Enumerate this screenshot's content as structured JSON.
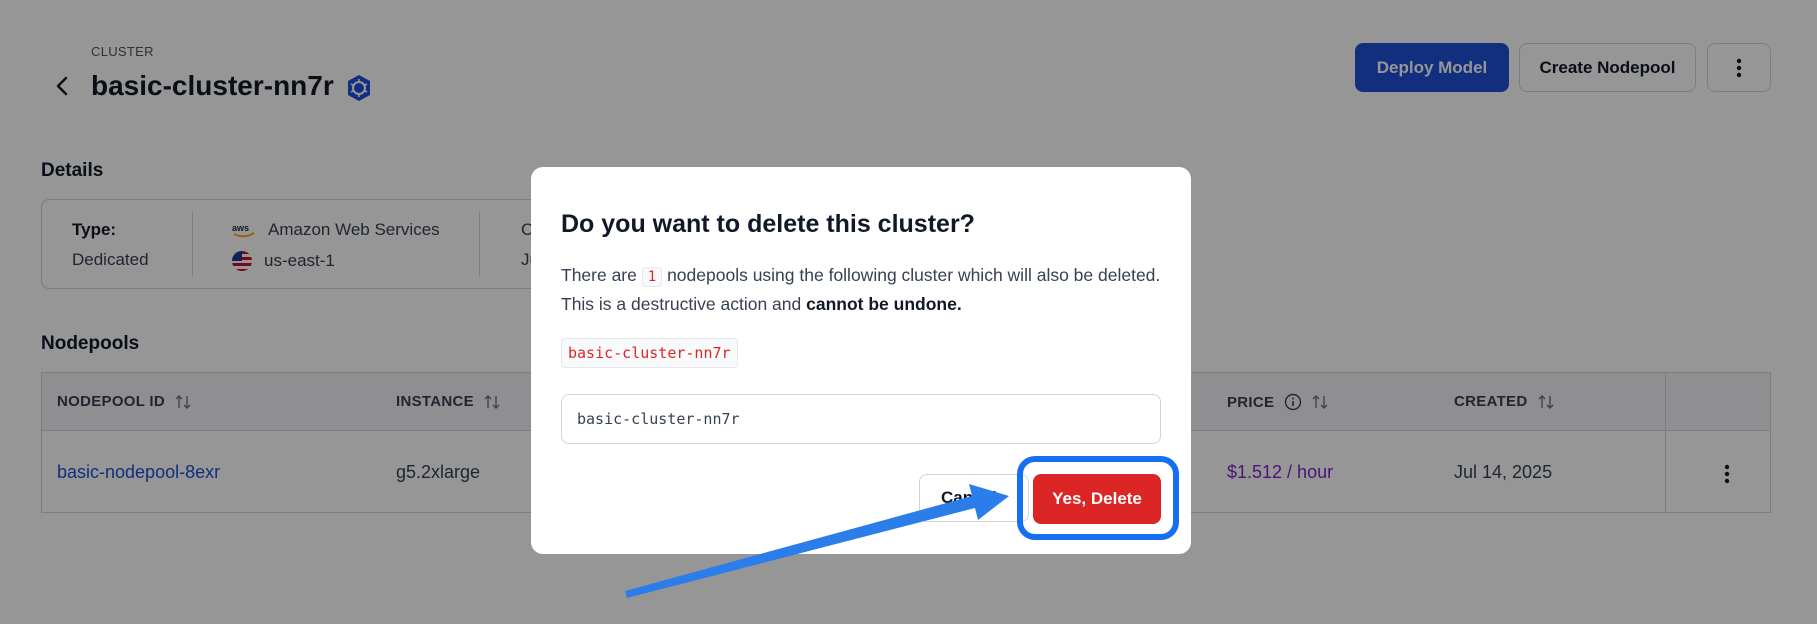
{
  "header": {
    "eyebrow": "CLUSTER",
    "title": "basic-cluster-nn7r",
    "deploy_label": "Deploy Model",
    "create_label": "Create Nodepool"
  },
  "details": {
    "section_title": "Details",
    "type_label": "Type:",
    "type_value": "Dedicated",
    "provider": "Amazon Web Services",
    "region": "us-east-1",
    "extra_label": "C",
    "extra_value": "Ju"
  },
  "nodepools": {
    "section_title": "Nodepools",
    "columns": [
      "NODEPOOL ID",
      "INSTANCE",
      "PRICE",
      "CREATED"
    ],
    "rows": [
      {
        "id": "basic-nodepool-8exr",
        "instance": "g5.2xlarge",
        "price": "$1.512 / hour",
        "created": "Jul 14, 2025"
      }
    ]
  },
  "modal": {
    "title": "Do you want to delete this cluster?",
    "text_1": "There are",
    "count": "1",
    "text_2": "nodepools using the following cluster which will also be deleted. This is a destructive action and",
    "text_bold": "cannot be undone.",
    "cluster_name": "basic-cluster-nn7r",
    "input_value": "basic-cluster-nn7r",
    "cancel_label": "Cancel",
    "delete_label": "Yes, Delete"
  },
  "colors": {
    "primary": "#1d4ed8",
    "danger": "#dc2626",
    "price": "#7e22ce",
    "highlight": "#1570ef"
  }
}
